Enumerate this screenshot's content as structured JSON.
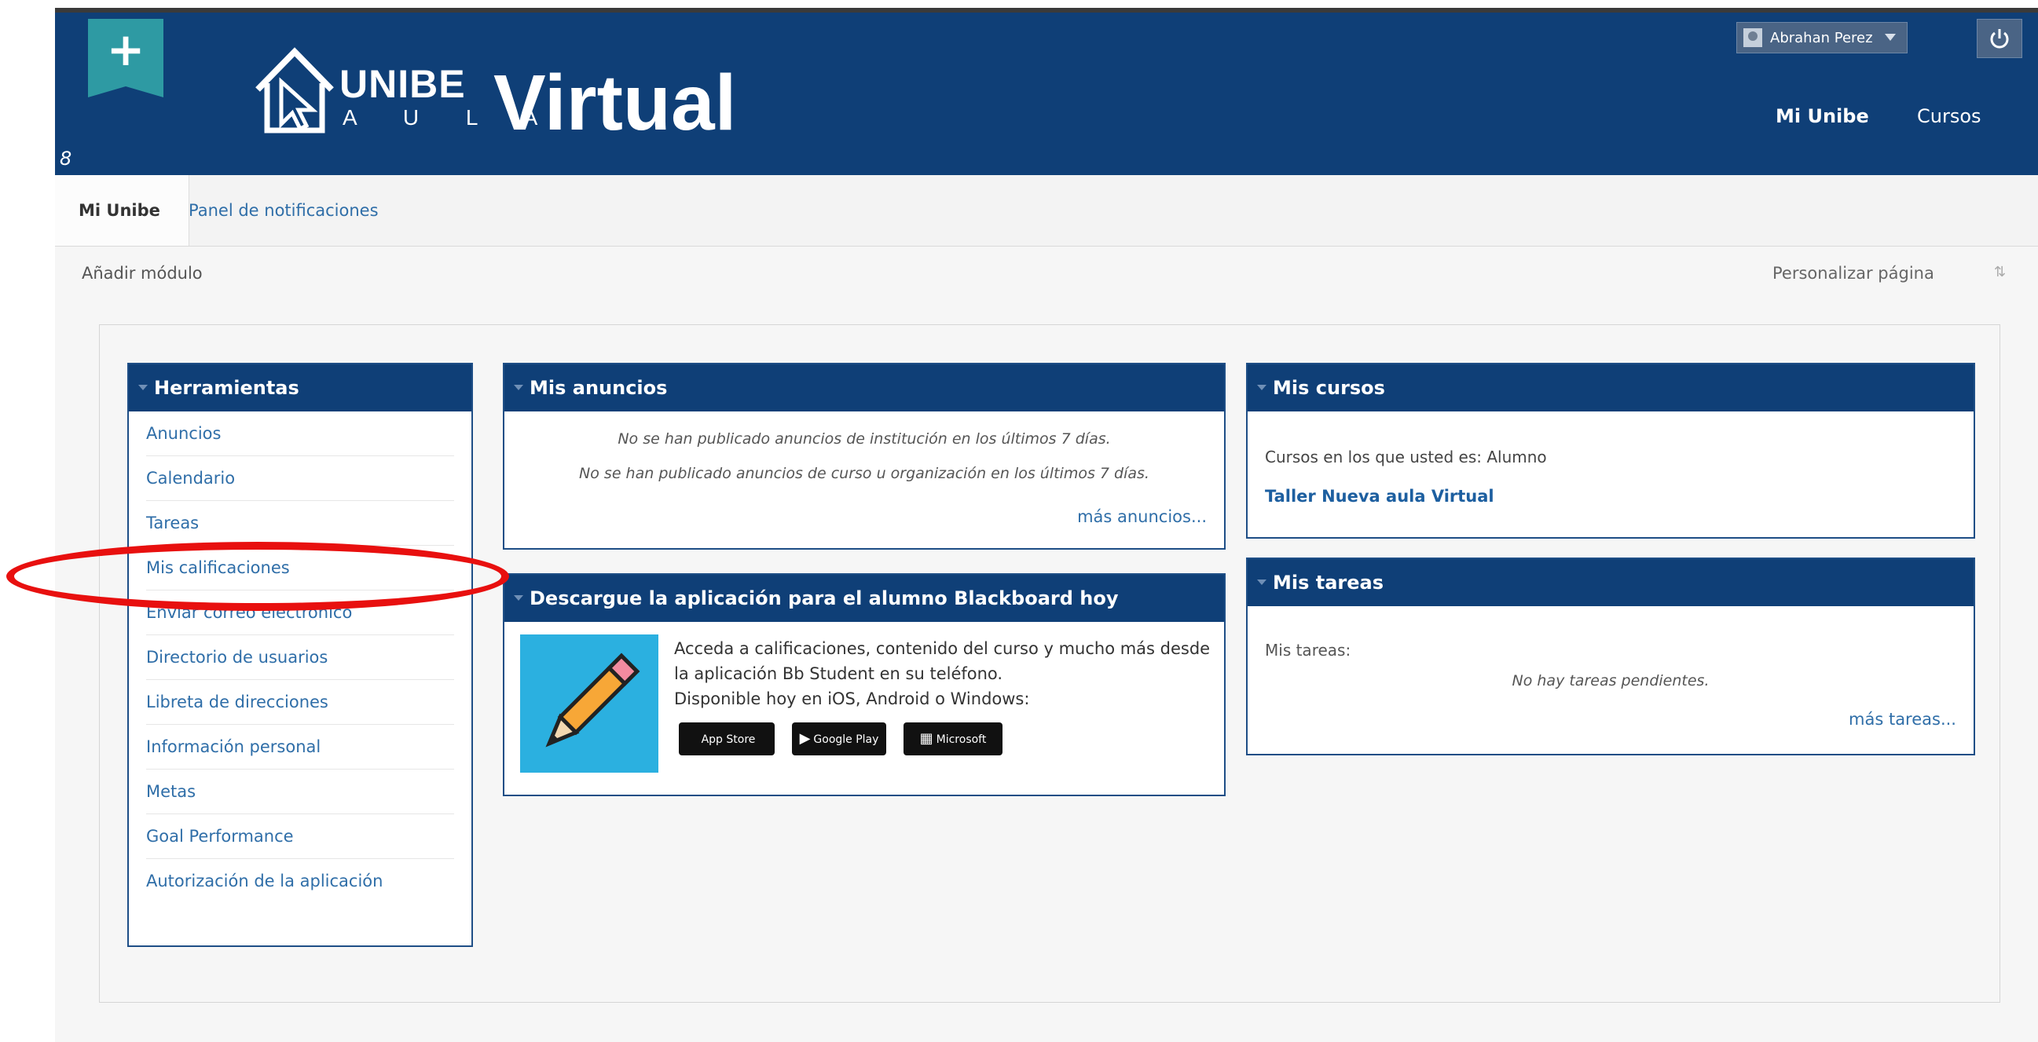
{
  "header": {
    "add_icon": "plus-icon",
    "logo": {
      "brand": "UNIBE",
      "sub": "A U L A",
      "product": "Virtual"
    },
    "user_name": "Abrahan Perez",
    "nav": [
      {
        "label": "Mi Unibe"
      },
      {
        "label": "Cursos"
      }
    ]
  },
  "tabs": [
    {
      "label": "Mi Unibe",
      "active": true
    },
    {
      "label": "Panel de notificaciones",
      "active": false
    }
  ],
  "toolbar": {
    "add_module": "Añadir módulo",
    "personalize": "Personalizar página"
  },
  "modules": {
    "tools": {
      "title": "Herramientas",
      "items": [
        "Anuncios",
        "Calendario",
        "Tareas",
        "Mis calificaciones",
        "Enviar correo electrónico",
        "Directorio de usuarios",
        "Libreta de direcciones",
        "Información personal",
        "Metas",
        "Goal Performance",
        "Autorización de la aplicación"
      ]
    },
    "announcements": {
      "title": "Mis anuncios",
      "line1": "No se han publicado anuncios de institución en los últimos 7 días.",
      "line2": "No se han publicado anuncios de curso u organización en los últimos 7 días.",
      "more": "más anuncios..."
    },
    "app": {
      "title": "Descargue la aplicación para el alumno Blackboard hoy",
      "line1": "Acceda a calificaciones, contenido del curso y mucho más desde",
      "line2": "la aplicación Bb Student en su teléfono.",
      "line3": "Disponible hoy en iOS, Android o Windows:",
      "stores": {
        "apple": "App Store",
        "google": "Google Play",
        "microsoft": "Microsoft"
      }
    },
    "courses": {
      "title": "Mis cursos",
      "role_text": "Cursos en los que usted es: Alumno",
      "course_link": "Taller Nueva aula Virtual"
    },
    "tasks": {
      "title": "Mis tareas",
      "label": "Mis tareas:",
      "empty": "No hay tareas pendientes.",
      "more": "más tareas..."
    }
  },
  "colors": {
    "header": "#0f3f77",
    "link": "#2f6ea8",
    "highlight": "#e8100f",
    "badge": "#2e9aa3"
  }
}
